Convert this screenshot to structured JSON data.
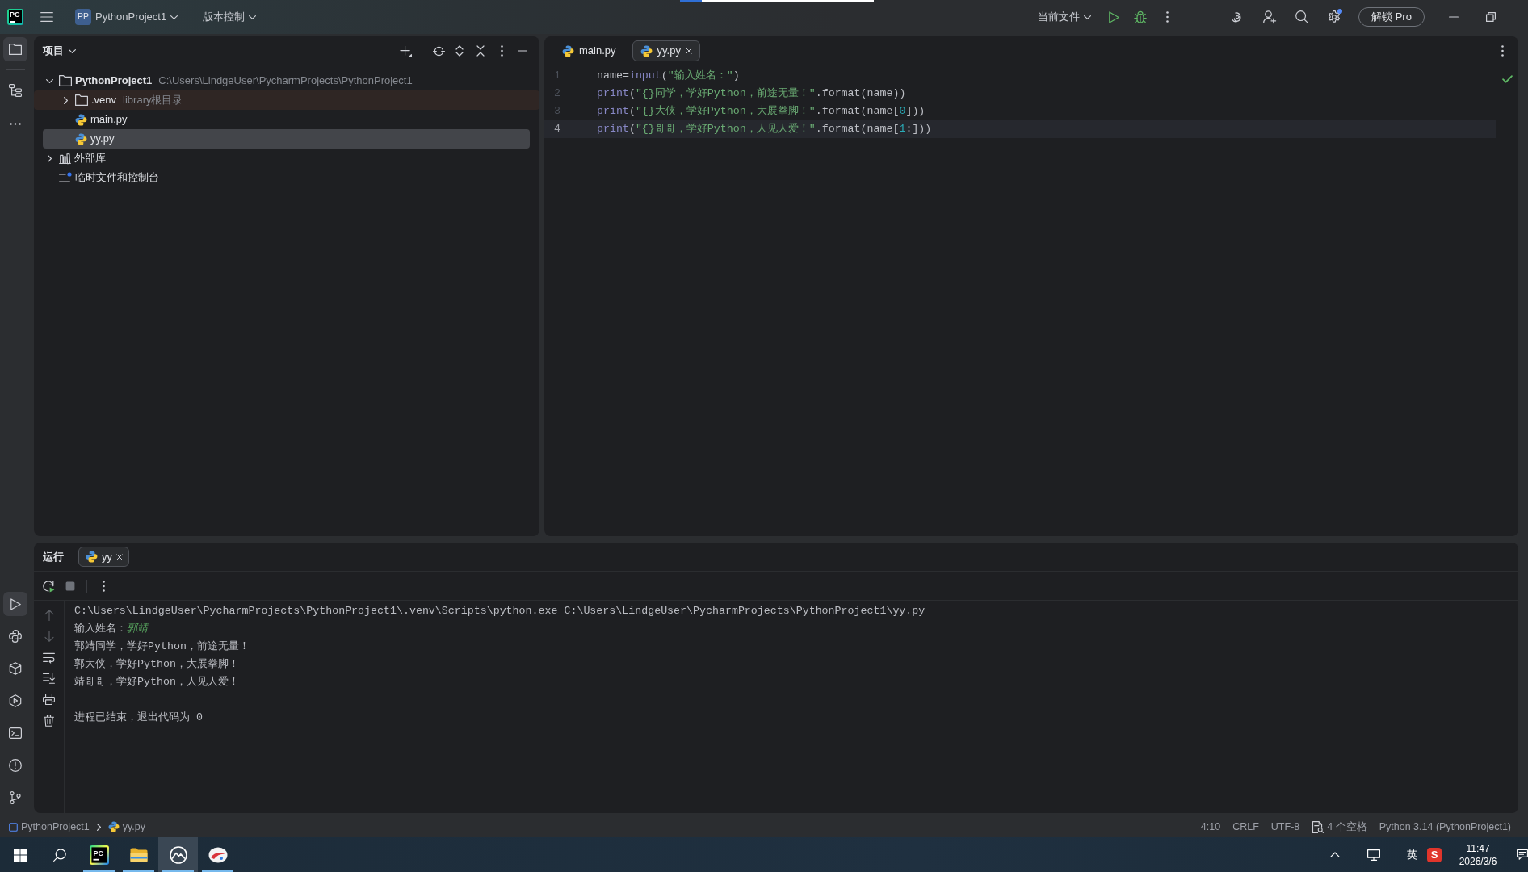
{
  "title_bar": {
    "logo": "PC",
    "project_badge": "PP",
    "project": "PythonProject1",
    "vcs": "版本控制",
    "run_config": "当前文件",
    "settings_notification": true,
    "pro_button": "解锁 Pro"
  },
  "tool_stripe": {
    "top": [
      {
        "kind": "project",
        "selected": true
      },
      {
        "kind": "structure",
        "selected": false
      },
      {
        "kind": "more",
        "selected": false
      }
    ],
    "bottom": [
      {
        "kind": "run",
        "selected": true
      },
      {
        "kind": "python_console",
        "selected": false
      },
      {
        "kind": "packages",
        "selected": false
      },
      {
        "kind": "services",
        "selected": false
      },
      {
        "kind": "terminal",
        "selected": false
      },
      {
        "kind": "problems",
        "selected": false
      },
      {
        "kind": "git",
        "selected": false
      }
    ]
  },
  "project_panel": {
    "title": "项目",
    "tree": [
      {
        "label": "PythonProject1",
        "kind": "project",
        "path": "C:\\Users\\LindgeUser\\PycharmProjects\\PythonProject1",
        "expanded": true,
        "selected": false,
        "children": [
          {
            "label": ".venv",
            "kind": "excluded_folder",
            "note": "library根目录",
            "expanded": false,
            "selected": false
          },
          {
            "label": "main.py",
            "kind": "python_file",
            "selected": false
          },
          {
            "label": "yy.py",
            "kind": "python_file",
            "selected": true
          }
        ]
      },
      {
        "label": "外部库",
        "kind": "library",
        "expanded": false,
        "selected": false
      },
      {
        "label": "临时文件和控制台",
        "kind": "scratches",
        "selected": false
      }
    ]
  },
  "editor": {
    "tabs": [
      {
        "label": "main.py",
        "selected": false
      },
      {
        "label": "yy.py",
        "selected": true
      }
    ],
    "inspection_ok": true,
    "lines": [
      {
        "number": "1",
        "current": false,
        "tokens": [
          {
            "kind": "plain",
            "text": "name="
          },
          {
            "kind": "builtin",
            "text": "input"
          },
          {
            "kind": "plain",
            "text": "("
          },
          {
            "kind": "string",
            "text": "\"输入姓名：\""
          },
          {
            "kind": "plain",
            "text": ")"
          }
        ]
      },
      {
        "number": "2",
        "current": false,
        "tokens": [
          {
            "kind": "builtin",
            "text": "print"
          },
          {
            "kind": "plain",
            "text": "("
          },
          {
            "kind": "string",
            "text": "\"{}同学，学好Python，前途无量！\""
          },
          {
            "kind": "plain",
            "text": ".format(name))"
          }
        ]
      },
      {
        "number": "3",
        "current": false,
        "tokens": [
          {
            "kind": "builtin",
            "text": "print"
          },
          {
            "kind": "plain",
            "text": "("
          },
          {
            "kind": "string",
            "text": "\"{}大侠，学好Python，大展拳脚！\""
          },
          {
            "kind": "plain",
            "text": ".format(name["
          },
          {
            "kind": "number",
            "text": "0"
          },
          {
            "kind": "plain",
            "text": "]))"
          }
        ]
      },
      {
        "number": "4",
        "current": true,
        "tokens": [
          {
            "kind": "builtin",
            "text": "print"
          },
          {
            "kind": "plain",
            "text": "("
          },
          {
            "kind": "string",
            "text": "\"{}哥哥，学好Python，人见人爱！\""
          },
          {
            "kind": "plain",
            "text": ".format(name["
          },
          {
            "kind": "number",
            "text": "1"
          },
          {
            "kind": "plain",
            "text": ":]))"
          }
        ]
      }
    ]
  },
  "run_panel": {
    "title": "运行",
    "tabs": [
      {
        "label": "yy",
        "selected": true
      }
    ],
    "stop_disabled": true,
    "console_tools": [
      {
        "kind": "up",
        "disabled": true
      },
      {
        "kind": "down",
        "disabled": true
      },
      {
        "kind": "wrap",
        "disabled": false
      },
      {
        "kind": "scroll_end",
        "disabled": false
      },
      {
        "kind": "print",
        "disabled": false
      },
      {
        "kind": "clear",
        "disabled": false
      }
    ],
    "console": [
      {
        "kind": "command",
        "text": "C:\\Users\\LindgeUser\\PycharmProjects\\PythonProject1\\.venv\\Scripts\\python.exe C:\\Users\\LindgeUser\\PycharmProjects\\PythonProject1\\yy.py"
      },
      {
        "kind": "prompt",
        "text": "输入姓名：",
        "input": "郭靖"
      },
      {
        "kind": "output",
        "text": "郭靖同学，学好Python，前途无量！"
      },
      {
        "kind": "output",
        "text": "郭大侠，学好Python，大展拳脚！"
      },
      {
        "kind": "output",
        "text": "靖哥哥，学好Python，人见人爱！"
      },
      {
        "kind": "exit",
        "text": "进程已结束，退出代码为 0"
      }
    ]
  },
  "status_bar": {
    "breadcrumbs": [
      {
        "kind": "project",
        "label": "PythonProject1"
      },
      {
        "kind": "python_file",
        "label": "yy.py"
      }
    ],
    "items": [
      {
        "kind": "text",
        "label": "4:10"
      },
      {
        "kind": "text",
        "label": "CRLF"
      },
      {
        "kind": "text",
        "label": "UTF-8"
      },
      {
        "kind": "indent",
        "label": "4 个空格"
      },
      {
        "kind": "text",
        "label": "Python 3.14 (PythonProject1)"
      }
    ]
  },
  "taskbar": {
    "apps": [
      {
        "kind": "start",
        "selected": false,
        "running": false
      },
      {
        "kind": "search",
        "selected": false,
        "running": false
      },
      {
        "kind": "ide",
        "label": "PC",
        "selected": false,
        "running": true
      },
      {
        "kind": "files",
        "selected": false,
        "running": true
      },
      {
        "kind": "photos",
        "selected": true,
        "running": true
      },
      {
        "kind": "paint",
        "selected": false,
        "running": true
      }
    ],
    "tray": [
      {
        "kind": "overflow"
      },
      {
        "kind": "network"
      },
      {
        "kind": "language",
        "label": "英"
      },
      {
        "kind": "ime",
        "label": "S"
      }
    ],
    "time": "11:47",
    "date": "2026/3/6"
  }
}
